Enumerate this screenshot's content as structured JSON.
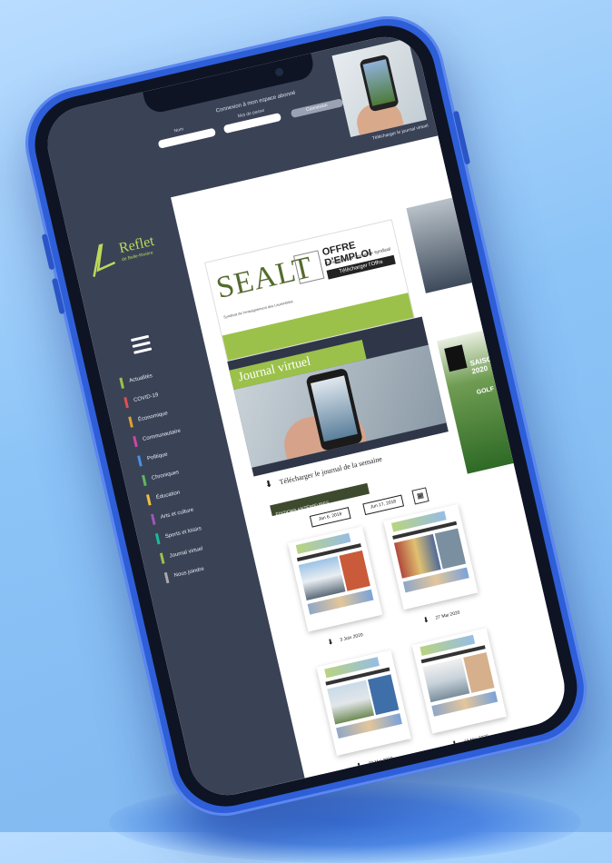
{
  "site": {
    "logo_text": "Reflet",
    "logo_sub": "de Belle-Rivière",
    "login": {
      "title": "Connexion à mon espace abonné",
      "user_label": "Nom",
      "password_label": "Mot de passe",
      "submit_label": "Connexion"
    },
    "top_thumb_caption": "Télécharger le journal virtuel",
    "menu": [
      {
        "label": "Actualités",
        "color": "#9bc14a"
      },
      {
        "label": "COVID-19",
        "color": "#e05050"
      },
      {
        "label": "Économique",
        "color": "#e0a030"
      },
      {
        "label": "Communautaire",
        "color": "#c84aa0"
      },
      {
        "label": "Politique",
        "color": "#4a90e2"
      },
      {
        "label": "Chroniques",
        "color": "#5cb85c"
      },
      {
        "label": "Éducation",
        "color": "#f0c040"
      },
      {
        "label": "Arts et culture",
        "color": "#9b59b6"
      },
      {
        "label": "Sports et loisirs",
        "color": "#1abc9c"
      },
      {
        "label": "Journal virtuel",
        "color": "#9bc14a"
      },
      {
        "label": "Nous joindre",
        "color": "#aaaaaa"
      }
    ],
    "banner": {
      "brand": "SEALT",
      "brand_sub": "Syndicat de l'enseignement des Laurentides",
      "title": "OFFRE D'EMPLOI",
      "subtitle": "Conseillère ou conseiller syndical",
      "button": "Télécharger l'Offre"
    },
    "ad_right_2": {
      "line1": "SAISON 2020",
      "line2": "GOLF"
    },
    "journal": {
      "title": "Journal virtuel",
      "download_text": "Télécharger le journal de la semaine",
      "editions_label": "ÉDITIONS ANTÉRIEURES",
      "date_from": "Jan 6, 2018",
      "date_to": "Jun 17, 2018"
    },
    "editions": [
      {
        "date": "3 Juin 2020"
      },
      {
        "date": "27 Mai 2020"
      },
      {
        "date": "20 Mai 2020"
      },
      {
        "date": "13 Mai 2020"
      }
    ]
  }
}
